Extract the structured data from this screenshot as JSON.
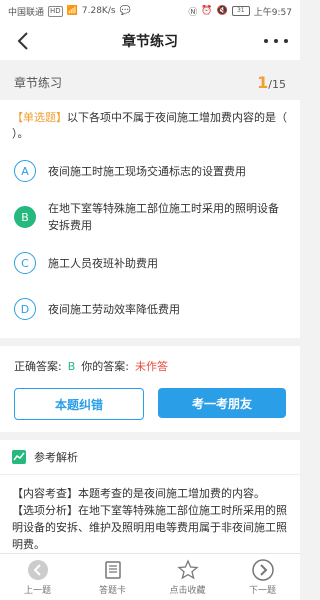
{
  "statusbar": {
    "carrier": "中国联通",
    "speed": "7.28K/s",
    "battery": "31",
    "time": "上午9:57"
  },
  "navbar": {
    "title": "章节练习"
  },
  "chapter": {
    "name": "章节练习",
    "current": "1",
    "total": "/15"
  },
  "question": {
    "type_label": "【单选题】",
    "text": "以下各项中不属于夜间施工增加费内容的是（ ）。",
    "options": [
      {
        "letter": "A",
        "text": "夜间施工时施工现场交通标志的设置费用"
      },
      {
        "letter": "B",
        "text": "在地下室等特殊施工部位施工时采用的照明设备安拆费用"
      },
      {
        "letter": "C",
        "text": "施工人员夜班补助费用"
      },
      {
        "letter": "D",
        "text": "夜间施工劳动效率降低费用"
      }
    ]
  },
  "answer": {
    "correct_label": "正确答案:",
    "correct_value": "B",
    "yours_label": "你的答案:",
    "yours_value": "未作答",
    "btn_report": "本题纠错",
    "btn_quiz_friend": "考一考朋友"
  },
  "analysis": {
    "title": "参考解析",
    "line1": "【内容考查】本题考查的是夜间施工增加费的内容。",
    "line2": "【选项分析】在地下室等特殊施工部位施工时所采用的照明设备的安拆、维护及照明用电等费用属于非夜间施工照明费。"
  },
  "bottombar": {
    "prev": "上一题",
    "card": "答题卡",
    "fav": "点击收藏",
    "next": "下一题"
  },
  "colors": {
    "accent": "#2b9ee8",
    "correct": "#25b97d",
    "warning": "#f0a030",
    "error": "#e74c3c"
  }
}
